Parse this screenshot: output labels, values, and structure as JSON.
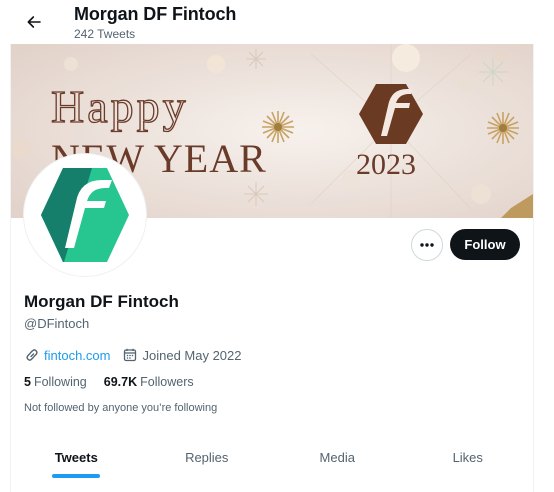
{
  "header": {
    "title": "Morgan DF Fintoch",
    "tweet_count": "242 Tweets",
    "back_icon": "arrow-left-icon"
  },
  "banner": {
    "line1": "Happy",
    "line2": "NEW YEAR",
    "year": "2023",
    "colors": {
      "background": "#efe6e1",
      "text": "#6b3b2a",
      "logo": "#6a3a22",
      "accent_gold": "#c8a263"
    }
  },
  "profile": {
    "name": "Morgan DF Fintoch",
    "handle": "@DFintoch",
    "website": "fintoch.com",
    "joined": "Joined May 2022",
    "following_count": "5",
    "following_label": "Following",
    "followers_count": "69.7K",
    "followers_label": "Followers",
    "social_context": "Not followed by anyone you’re following",
    "avatar_colors": {
      "dark": "#157f6c",
      "light": "#27c690"
    }
  },
  "actions": {
    "more_icon": "more-horizontal-icon",
    "follow_label": "Follow"
  },
  "tabs": [
    {
      "label": "Tweets",
      "active": true
    },
    {
      "label": "Replies",
      "active": false
    },
    {
      "label": "Media",
      "active": false
    },
    {
      "label": "Likes",
      "active": false
    }
  ],
  "colors": {
    "accent": "#1d9bf0",
    "text_primary": "#0f1419",
    "text_secondary": "#536471"
  }
}
